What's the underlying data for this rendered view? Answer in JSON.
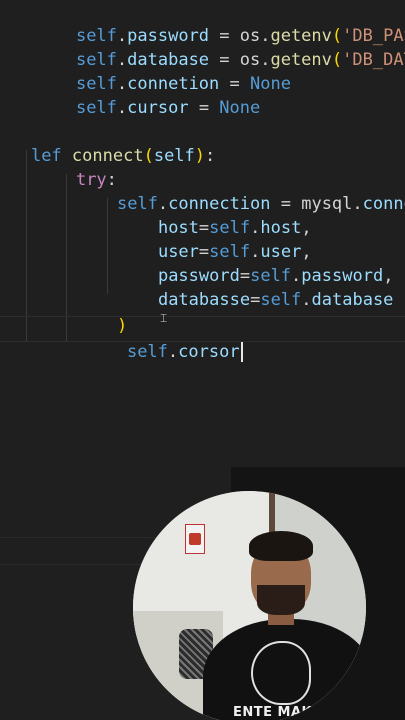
{
  "editor": {
    "code_lines": {
      "l1": {
        "self": "self",
        "dot": ".",
        "attr": "password",
        "op": " = os.",
        "fn": "getenv",
        "paren": "(",
        "str": "'DB_PASSWO"
      },
      "l2": {
        "self": "self",
        "dot": ".",
        "attr": "database",
        "op": " = os.",
        "fn": "getenv",
        "paren": "(",
        "str": "'DB_DATABA"
      },
      "l3": {
        "self": "self",
        "dot": ".",
        "attr": "connetion",
        "op": " = ",
        "kw": "None"
      },
      "l4": {
        "self": "self",
        "dot": ".",
        "attr": "cursor",
        "op": " = ",
        "kw": "None"
      },
      "l5": {
        "kw": "lef",
        "fn": "connect",
        "open": "(",
        "self": "self",
        "close": ")",
        "colon": ":"
      },
      "l6": {
        "ctrl": "try",
        "colon": ":"
      },
      "l7": {
        "self": "self",
        "dot": ".",
        "attr": "connection",
        "op": " = mysql.",
        "attr2": "connecto"
      },
      "l8": {
        "param": "host",
        "eq": "=",
        "self": "self",
        "dot": ".",
        "attr": "host",
        "comma": ","
      },
      "l9": {
        "param": "user",
        "eq": "=",
        "self": "self",
        "dot": ".",
        "attr": "user",
        "comma": ","
      },
      "l10": {
        "param": "password",
        "eq": "=",
        "self": "self",
        "dot": ".",
        "attr": "password",
        "comma": ","
      },
      "l11": {
        "param": "databasse",
        "eq": "=",
        "self": "self",
        "dot": ".",
        "attr": "database"
      },
      "l12": {
        "paren": ")"
      },
      "l13": {
        "self": "self",
        "dot": ".",
        "attr": "corsor"
      }
    }
  },
  "webcam": {
    "shirt_text": "ENTE MAKER"
  }
}
